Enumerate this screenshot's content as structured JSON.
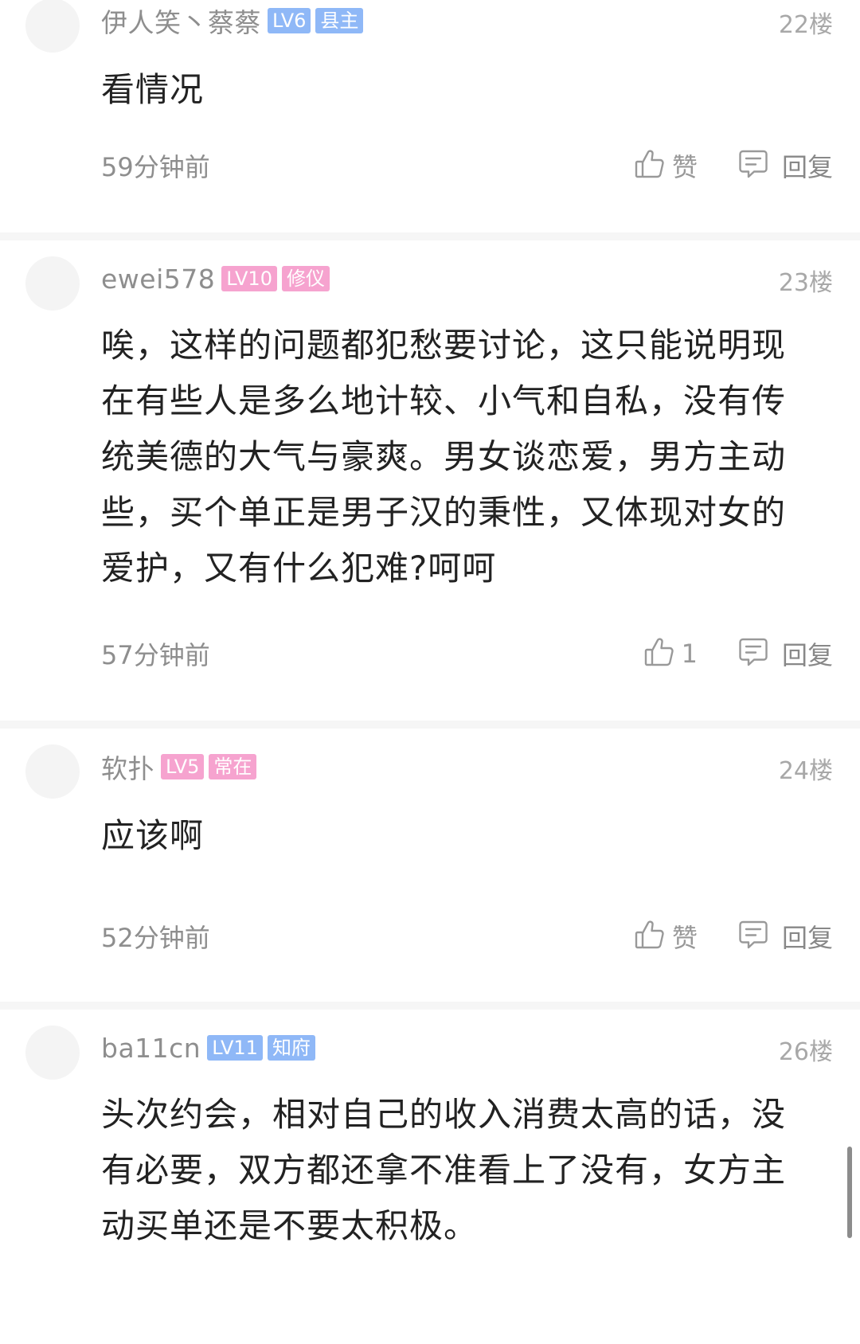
{
  "comments": [
    {
      "username": "伊人笑丶蔡蔡",
      "level": "LV6",
      "title": "县主",
      "badge_color": "#8fb8f7",
      "floor": "22楼",
      "content": "看情况",
      "time": "59分钟前",
      "like_label": "赞",
      "reply_label": "回复"
    },
    {
      "username": "ewei578",
      "level": "LV10",
      "title": "修仪",
      "badge_color": "#f6a3cf",
      "floor": "23楼",
      "content": "唉，这样的问题都犯愁要讨论，这只能说明现在有些人是多么地计较、小气和自私，没有传统美德的大气与豪爽。男女谈恋爱，男方主动些，买个单正是男子汉的秉性，又体现对女的爱护，又有什么犯难?呵呵",
      "time": "57分钟前",
      "like_label": "1",
      "reply_label": "回复"
    },
    {
      "username": "软扑",
      "level": "LV5",
      "title": "常在",
      "badge_color": "#f6a3cf",
      "floor": "24楼",
      "content": "应该啊",
      "time": "52分钟前",
      "like_label": "赞",
      "reply_label": "回复"
    },
    {
      "username": "ba11cn",
      "level": "LV11",
      "title": "知府",
      "badge_color": "#8fb8f7",
      "floor": "26楼",
      "content": "头次约会，相对自己的收入消费太高的话，没有必要，双方都还拿不准看上了没有，女方主动买单还是不要太积极。",
      "time": "",
      "like_label": "",
      "reply_label": ""
    }
  ],
  "icons": {
    "like": "thumbs-up-icon",
    "reply": "comment-bubble-icon"
  }
}
